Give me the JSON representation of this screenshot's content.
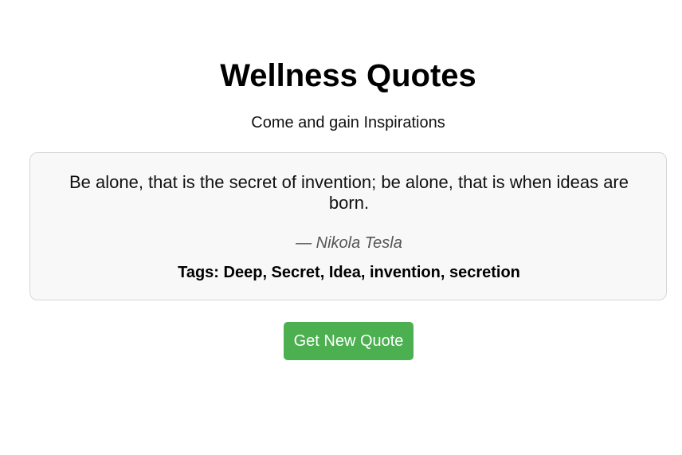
{
  "header": {
    "title": "Wellness Quotes",
    "subtitle": "Come and gain Inspirations"
  },
  "quote": {
    "text": "Be alone, that is the secret of invention; be alone, that is when ideas are born.",
    "author": "— Nikola Tesla",
    "tags_label": "Tags: ",
    "tags": "Deep, Secret, Idea, invention, secretion"
  },
  "actions": {
    "new_quote_label": "Get New Quote"
  },
  "colors": {
    "button_bg": "#4caf50",
    "card_bg": "#f8f8f8",
    "card_border": "#d6d6d6",
    "author_text": "#555555"
  }
}
